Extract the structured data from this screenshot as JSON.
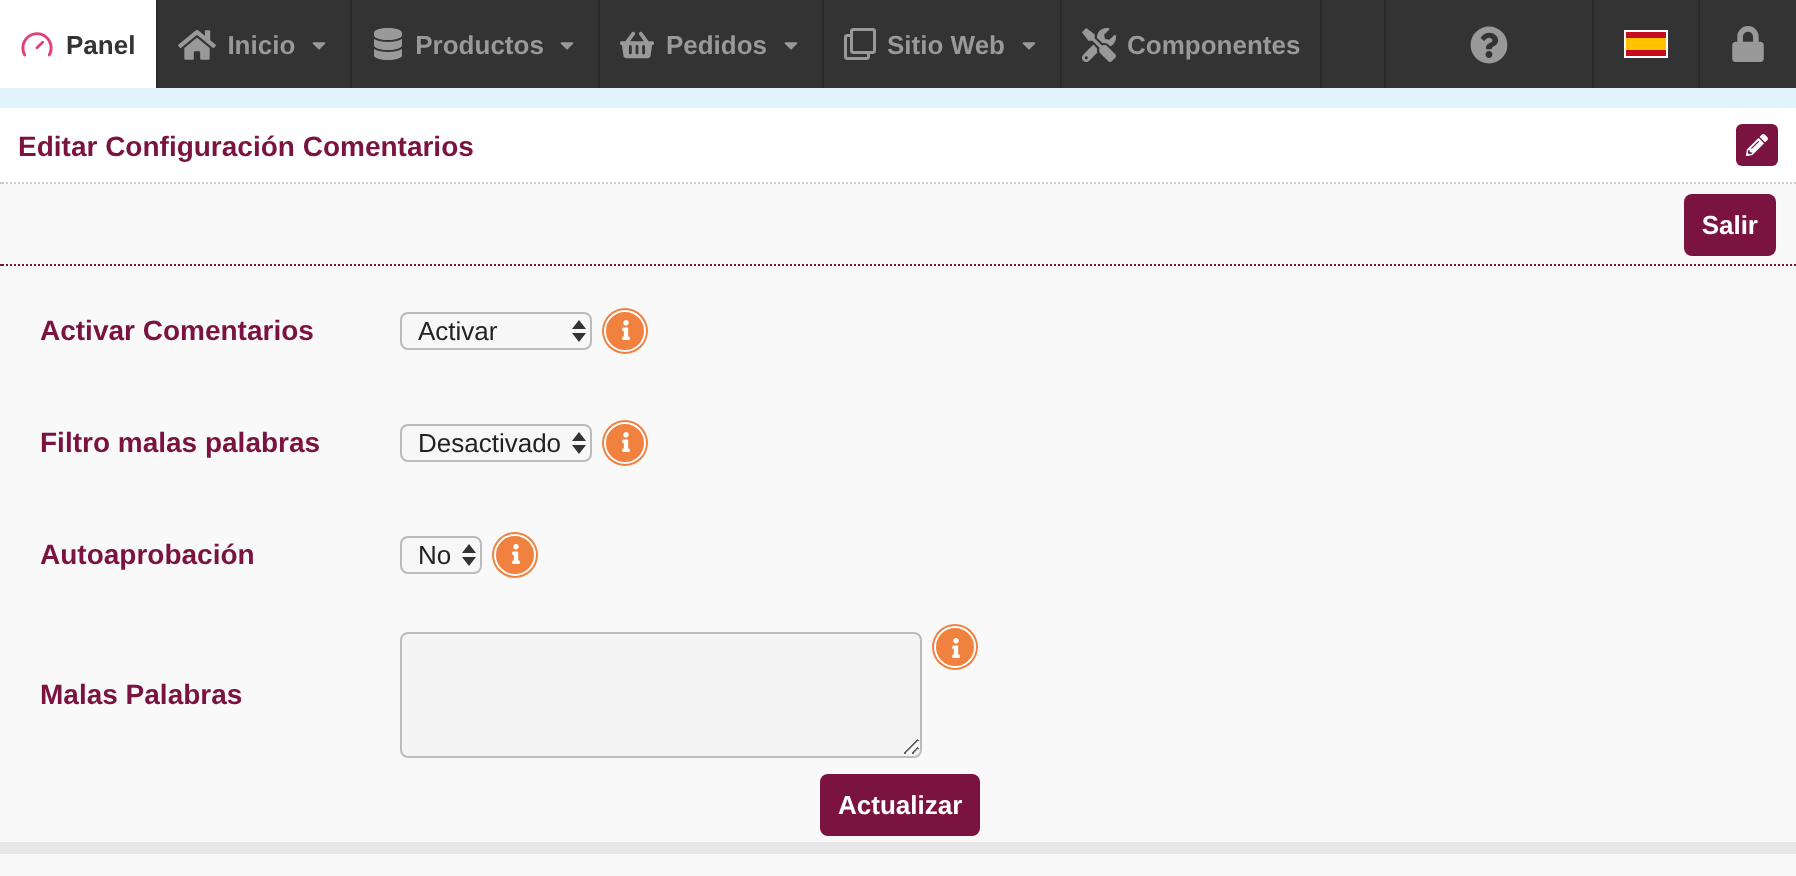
{
  "nav": {
    "items": [
      {
        "label": "Panel",
        "dropdown": false,
        "selected": true
      },
      {
        "label": "Inicio",
        "dropdown": true,
        "selected": false
      },
      {
        "label": "Productos",
        "dropdown": true,
        "selected": false
      },
      {
        "label": "Pedidos",
        "dropdown": true,
        "selected": false
      },
      {
        "label": "Sitio Web",
        "dropdown": true,
        "selected": false
      },
      {
        "label": "Componentes",
        "dropdown": false,
        "selected": false
      }
    ]
  },
  "page": {
    "title": "Editar Configuración Comentarios",
    "exit_button": "Salir"
  },
  "form": {
    "fields": [
      {
        "label": "Activar Comentarios",
        "kind": "select",
        "value": "Activar"
      },
      {
        "label": "Filtro malas palabras",
        "kind": "select",
        "value": "Desactivado"
      },
      {
        "label": "Autoaprobación",
        "kind": "select",
        "value": "No"
      },
      {
        "label": "Malas Palabras",
        "kind": "textarea"
      }
    ],
    "submit": "Actualizar"
  }
}
